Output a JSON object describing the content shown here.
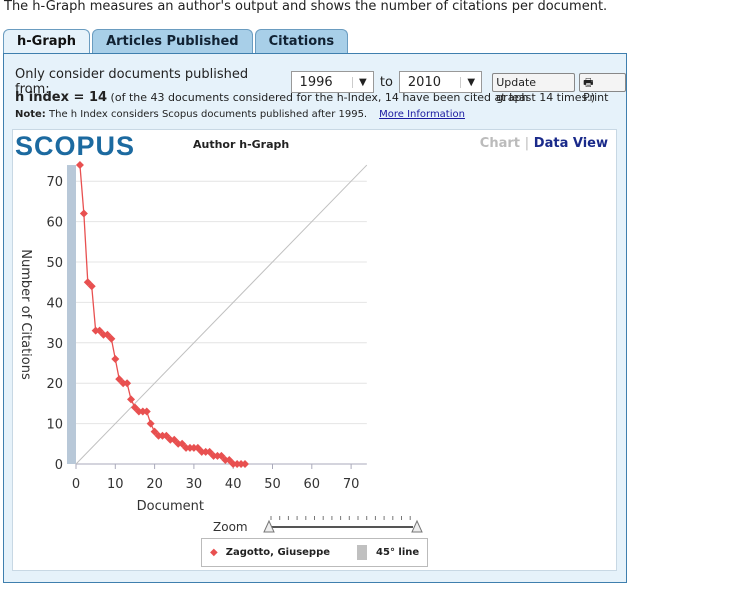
{
  "intro": "The h-Graph measures an author's output and shows the number of citations per document.",
  "tabs": [
    {
      "label": "h-Graph"
    },
    {
      "label": "Articles Published"
    },
    {
      "label": "Citations"
    }
  ],
  "filter": {
    "label": "Only consider documents published from:",
    "from": "1996",
    "to_label": "to",
    "to": "2010",
    "update": "Update graph",
    "print": "Print"
  },
  "hindex": {
    "label": "h index = 14",
    "detail": "(of the 43 documents considered for the h-Index, 14 have been cited at least 14 times.)"
  },
  "note": {
    "label": "Note:",
    "text": "The h Index considers Scopus documents published after 1995.",
    "link": "More Information"
  },
  "chart_header": {
    "logo": "SCOPUS",
    "title": "Author h-Graph",
    "chart": "Chart",
    "data_view": "Data View"
  },
  "chart_data": {
    "type": "scatter",
    "xlabel": "Document",
    "ylabel": "Number of Citations",
    "xlim": [
      0,
      74
    ],
    "ylim": [
      0,
      74
    ],
    "xticks": [
      0,
      10,
      20,
      30,
      40,
      50,
      60,
      70
    ],
    "yticks": [
      0,
      10,
      20,
      30,
      40,
      50,
      60,
      70
    ],
    "grid": true,
    "legend_placement": "bottom",
    "series": [
      {
        "name": "Zagotto, Giuseppe",
        "color": "#e85050",
        "x": [
          1,
          2,
          3,
          4,
          5,
          6,
          7,
          8,
          9,
          10,
          11,
          12,
          13,
          14,
          15,
          16,
          17,
          18,
          19,
          20,
          21,
          22,
          23,
          24,
          25,
          26,
          27,
          28,
          29,
          30,
          31,
          32,
          33,
          34,
          35,
          36,
          37,
          38,
          39,
          40,
          41,
          42,
          43
        ],
        "y": [
          74,
          62,
          45,
          44,
          33,
          33,
          32,
          32,
          31,
          26,
          21,
          20,
          20,
          16,
          14,
          13,
          13,
          13,
          10,
          8,
          7,
          7,
          7,
          6,
          6,
          5,
          5,
          4,
          4,
          4,
          4,
          3,
          3,
          3,
          2,
          2,
          2,
          1,
          1,
          0,
          0,
          0,
          0
        ]
      },
      {
        "name": "45° line",
        "color": "#c0c0c0"
      }
    ]
  },
  "zoom_label": "Zoom"
}
